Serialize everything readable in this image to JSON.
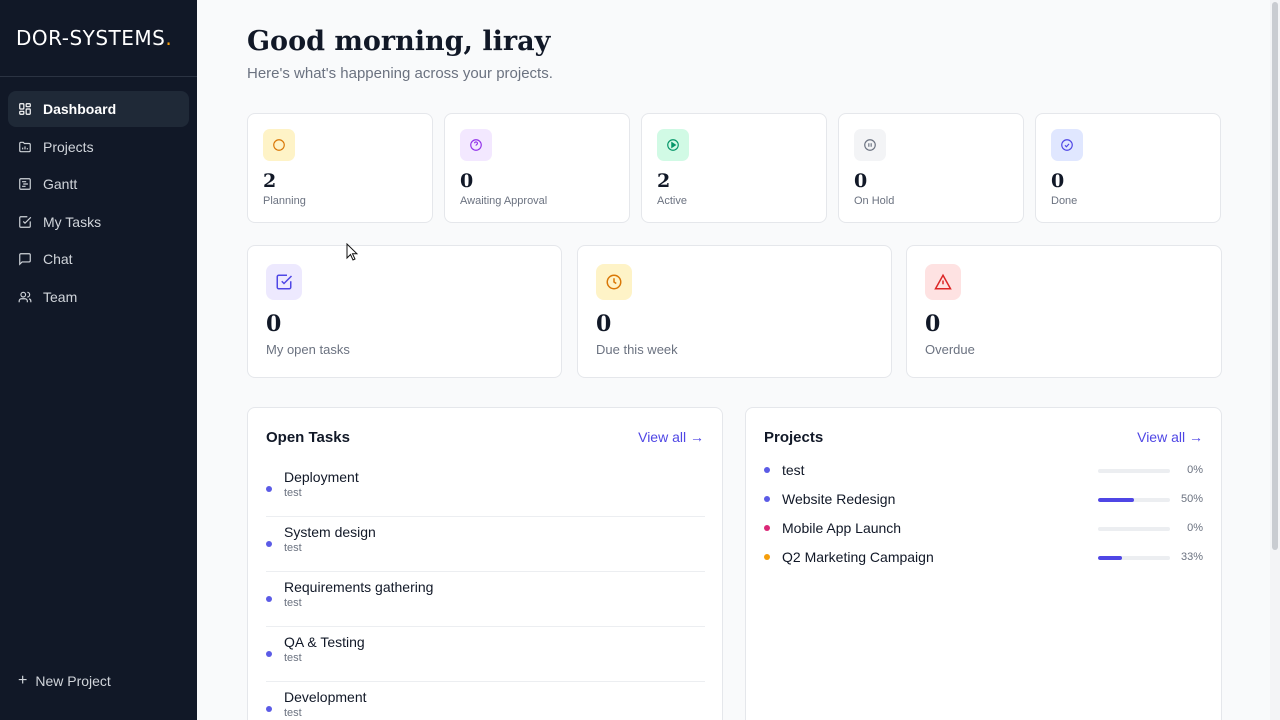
{
  "brand": {
    "name": "DOR-SYSTEMS",
    "dot": "."
  },
  "nav": [
    {
      "label": "Dashboard",
      "icon": "dashboard-icon"
    },
    {
      "label": "Projects",
      "icon": "folder-icon"
    },
    {
      "label": "Gantt",
      "icon": "gantt-icon"
    },
    {
      "label": "My Tasks",
      "icon": "check-square-icon"
    },
    {
      "label": "Chat",
      "icon": "chat-icon"
    },
    {
      "label": "Team",
      "icon": "users-icon"
    }
  ],
  "new_project": {
    "label": "New Project"
  },
  "header": {
    "greeting": "Good morning, liray",
    "subtitle": "Here's what's happening across your projects."
  },
  "status_cards": [
    {
      "count": "2",
      "label": "Planning",
      "icon": "circle-icon",
      "color": "#d97706",
      "bg": "#fef3c7"
    },
    {
      "count": "0",
      "label": "Awaiting Approval",
      "icon": "question-icon",
      "color": "#9333ea",
      "bg": "#f3e8ff"
    },
    {
      "count": "2",
      "label": "Active",
      "icon": "play-icon",
      "color": "#059669",
      "bg": "#d1fae5"
    },
    {
      "count": "0",
      "label": "On Hold",
      "icon": "pause-icon",
      "color": "#6b7280",
      "bg": "#f3f4f6"
    },
    {
      "count": "0",
      "label": "Done",
      "icon": "check-circle-icon",
      "color": "#4f46e5",
      "bg": "#e0e7ff"
    }
  ],
  "summary_cards": [
    {
      "count": "0",
      "label": "My open tasks",
      "icon": "checkbox-icon",
      "color": "#4f46e5",
      "bg": "#ede9fe"
    },
    {
      "count": "0",
      "label": "Due this week",
      "icon": "clock-icon",
      "color": "#d97706",
      "bg": "#fef3c7"
    },
    {
      "count": "0",
      "label": "Overdue",
      "icon": "alert-icon",
      "color": "#dc2626",
      "bg": "#fee2e2"
    }
  ],
  "open_tasks": {
    "title": "Open Tasks",
    "view_all": "View all →",
    "items": [
      {
        "name": "Deployment",
        "project": "test"
      },
      {
        "name": "System design",
        "project": "test"
      },
      {
        "name": "Requirements gathering",
        "project": "test"
      },
      {
        "name": "QA & Testing",
        "project": "test"
      },
      {
        "name": "Development",
        "project": "test"
      }
    ]
  },
  "projects": {
    "title": "Projects",
    "view_all": "View all →",
    "items": [
      {
        "name": "test",
        "progress": 0,
        "percent": "0%",
        "color": "#5b5be6"
      },
      {
        "name": "Website Redesign",
        "progress": 50,
        "percent": "50%",
        "color": "#5b5be6"
      },
      {
        "name": "Mobile App Launch",
        "progress": 0,
        "percent": "0%",
        "color": "#db2777"
      },
      {
        "name": "Q2 Marketing Campaign",
        "progress": 33,
        "percent": "33%",
        "color": "#f59e0b"
      }
    ]
  }
}
